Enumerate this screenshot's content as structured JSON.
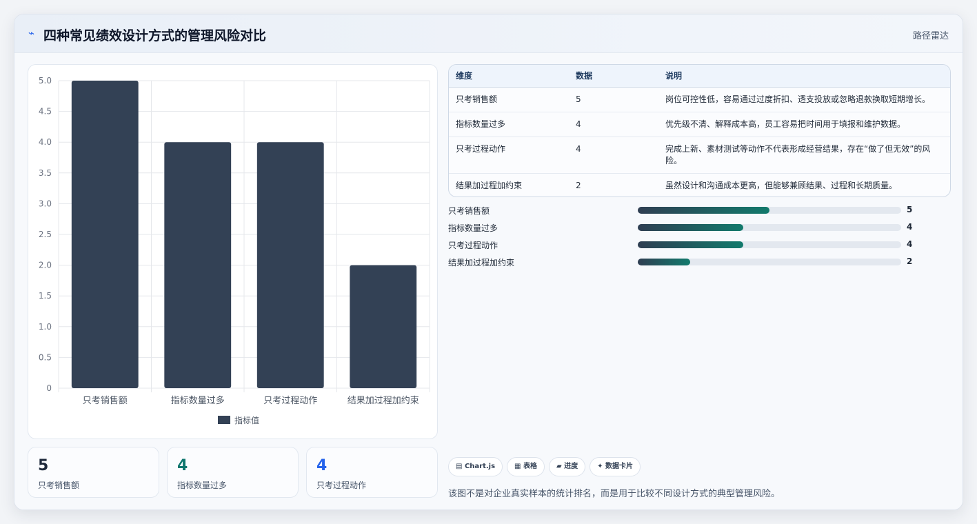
{
  "header": {
    "icon": "pulse-icon",
    "icon_glyph": "⌁",
    "title": "四种常见绩效设计方式的管理风险对比",
    "tag": "路径雷达"
  },
  "chart_data": {
    "type": "bar",
    "categories": [
      "只考销售额",
      "指标数量过多",
      "只考过程动作",
      "结果加过程加约束"
    ],
    "series": [
      {
        "name": "指标值",
        "values": [
          5,
          4,
          4,
          2
        ],
        "color": "#334155"
      }
    ],
    "ylim": [
      0,
      5
    ],
    "yticks": [
      "0",
      "0.5",
      "1.0",
      "1.5",
      "2.0",
      "2.5",
      "3.0",
      "3.5",
      "4.0",
      "4.5",
      "5.0"
    ],
    "grid": true,
    "legend": "bottom"
  },
  "stats": [
    {
      "value": "5",
      "label": "只考销售额",
      "color": "#1e293b"
    },
    {
      "value": "4",
      "label": "指标数量过多",
      "color": "#0f766e"
    },
    {
      "value": "4",
      "label": "只考过程动作",
      "color": "#2563eb"
    }
  ],
  "table": {
    "headers": [
      "维度",
      "数据",
      "说明"
    ],
    "rows": [
      [
        "只考销售额",
        "5",
        "岗位可控性低，容易通过过度折扣、透支投放或忽略退款换取短期增长。"
      ],
      [
        "指标数量过多",
        "4",
        "优先级不清、解释成本高，员工容易把时间用于填报和维护数据。"
      ],
      [
        "只考过程动作",
        "4",
        "完成上新、素材测试等动作不代表形成经营结果，存在“做了但无效”的风险。"
      ],
      [
        "结果加过程加约束",
        "2",
        "虽然设计和沟通成本更高，但能够兼顾结果、过程和长期质量。"
      ]
    ]
  },
  "progress": [
    {
      "label": "只考销售额",
      "value": 5
    },
    {
      "label": "指标数量过多",
      "value": 4
    },
    {
      "label": "只考过程动作",
      "value": 4
    },
    {
      "label": "结果加过程加约束",
      "value": 2
    }
  ],
  "chips": [
    {
      "icon": "chart-icon",
      "glyph": "▤",
      "label": "Chart.js"
    },
    {
      "icon": "table-icon",
      "glyph": "▦",
      "label": "表格"
    },
    {
      "icon": "progress-icon",
      "glyph": "▰",
      "label": "进度"
    },
    {
      "icon": "sparkle-icon",
      "glyph": "✦",
      "label": "数据卡片"
    }
  ],
  "note": "该图不是对企业真实样本的统计排名，而是用于比较不同设计方式的典型管理风险。"
}
